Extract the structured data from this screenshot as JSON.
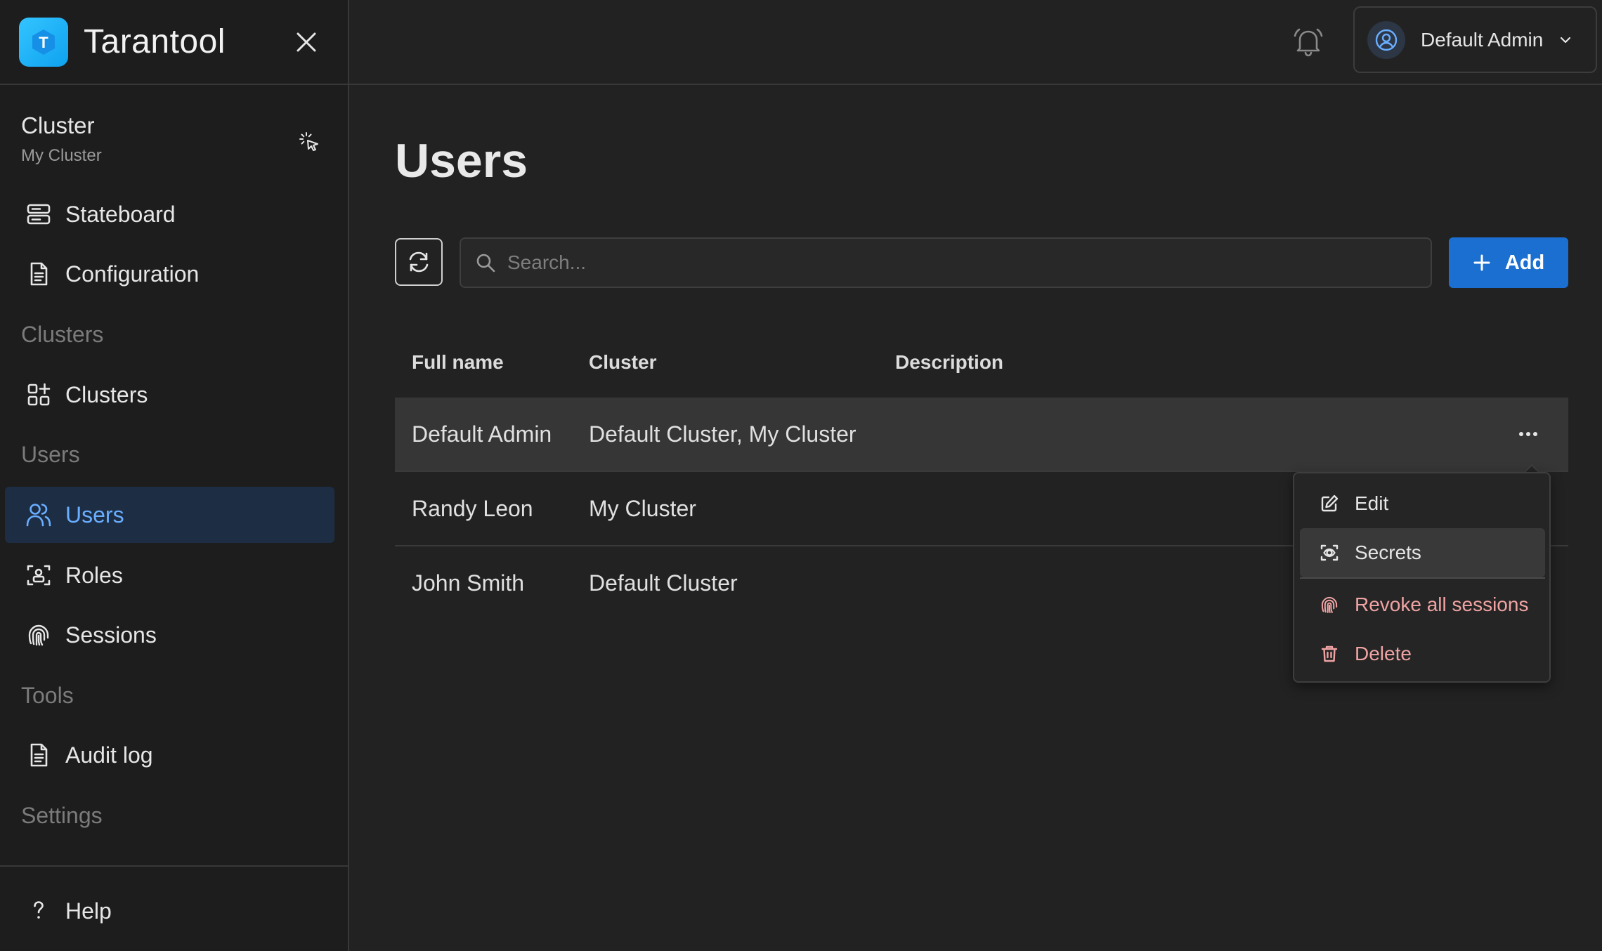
{
  "app": {
    "name": "Tarantool",
    "logo_letter": "T"
  },
  "sidebar": {
    "cluster": {
      "label": "Cluster",
      "name": "My Cluster"
    },
    "items": [
      {
        "id": "stateboard",
        "label": "Stateboard",
        "icon": "server-icon"
      },
      {
        "id": "configuration",
        "label": "Configuration",
        "icon": "document-icon"
      },
      {
        "section": "Clusters"
      },
      {
        "id": "clusters",
        "label": "Clusters",
        "icon": "grid-plus-icon"
      },
      {
        "section": "Users"
      },
      {
        "id": "users",
        "label": "Users",
        "icon": "users-icon",
        "active": true
      },
      {
        "id": "roles",
        "label": "Roles",
        "icon": "badge-icon"
      },
      {
        "id": "sessions",
        "label": "Sessions",
        "icon": "fingerprint-icon"
      },
      {
        "section": "Tools"
      },
      {
        "id": "audit-log",
        "label": "Audit log",
        "icon": "document-icon"
      },
      {
        "section": "Settings"
      }
    ],
    "help": {
      "label": "Help",
      "icon": "question-icon"
    }
  },
  "header": {
    "user_name": "Default Admin"
  },
  "main": {
    "title": "Users",
    "search": {
      "placeholder": "Search...",
      "value": ""
    },
    "add_label": "Add",
    "table": {
      "columns": [
        "Full name",
        "Cluster",
        "Description"
      ],
      "rows": [
        {
          "full_name": "Default Admin",
          "cluster": "Default Cluster, My Cluster",
          "description": ""
        },
        {
          "full_name": "Randy Leon",
          "cluster": "My Cluster",
          "description": ""
        },
        {
          "full_name": "John Smith",
          "cluster": "Default Cluster",
          "description": ""
        }
      ]
    },
    "row_menu": {
      "items": [
        {
          "label": "Edit",
          "icon": "edit-icon",
          "danger": false
        },
        {
          "label": "Secrets",
          "icon": "scan-icon",
          "danger": false
        },
        {
          "label": "Revoke all sessions",
          "icon": "fingerprint-icon",
          "danger": true
        },
        {
          "label": "Delete",
          "icon": "trash-icon",
          "danger": true
        }
      ]
    }
  },
  "colors": {
    "background": "#222222",
    "sidebar": "#1d1d1d",
    "accent": "#1a6fd1",
    "active_nav_bg": "#1c2d44",
    "active_nav_text": "#6aaeff",
    "danger_text": "#f0a3a3"
  }
}
